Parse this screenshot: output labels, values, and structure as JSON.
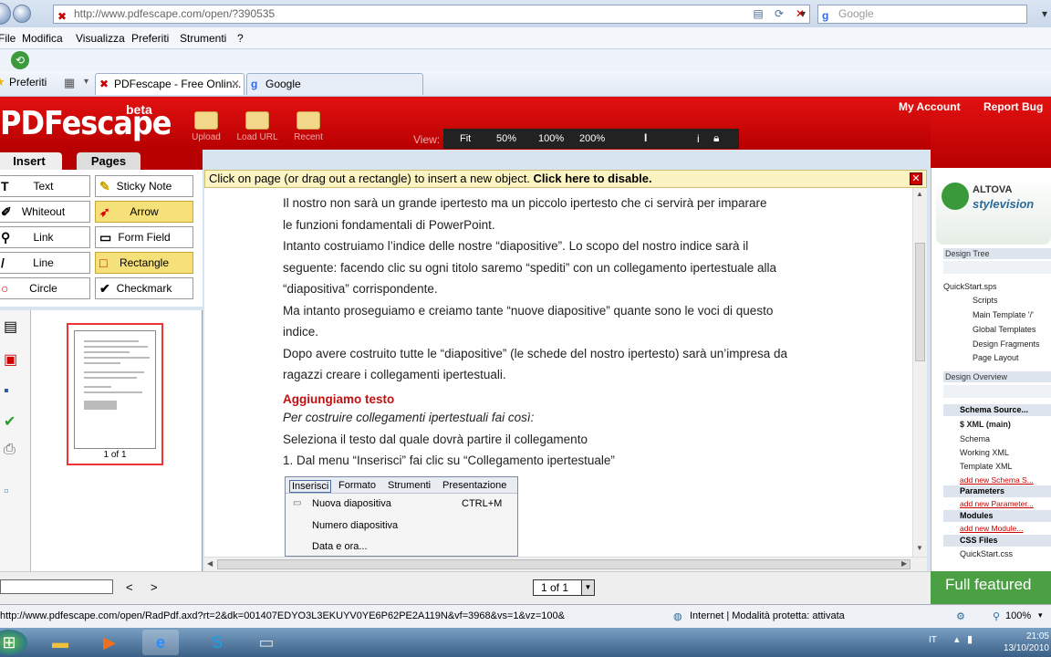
{
  "browser": {
    "url": "http://www.pdfescape.com/open/?390535",
    "search_placeholder": "Google",
    "menu": [
      "File",
      "Modifica",
      "Visualizza",
      "Preferiti",
      "Strumenti",
      "?"
    ],
    "favorites_label": "Preferiti",
    "tabs": [
      "PDFescape - Free Onlin...",
      "Google"
    ]
  },
  "app": {
    "logo": "PDFescape",
    "beta": "beta",
    "header_buttons": [
      "Upload",
      "Load URL",
      "Recent"
    ],
    "view_label": "View:",
    "zoom_options": [
      "Fit",
      "50%",
      "100%",
      "200%"
    ],
    "my_account": "My Account",
    "report_bug": "Report Bug",
    "panel_tabs": [
      "Insert",
      "Pages"
    ],
    "tools": [
      {
        "label": "Text",
        "icon": "T"
      },
      {
        "label": "Sticky Note",
        "icon": "✎"
      },
      {
        "label": "Whiteout",
        "icon": "✐"
      },
      {
        "label": "Arrow",
        "icon": "➶"
      },
      {
        "label": "Link",
        "icon": "⚲"
      },
      {
        "label": "Form Field",
        "icon": "▭"
      },
      {
        "label": "Line",
        "icon": "/"
      },
      {
        "label": "Rectangle",
        "icon": "□"
      },
      {
        "label": "Circle",
        "icon": "○"
      },
      {
        "label": "Checkmark",
        "icon": "✔"
      }
    ],
    "thumb_label": "1 of 1",
    "notice": "Click on page (or drag out a rectangle) to insert a new object.",
    "notice_link": "Click here to disable.",
    "page_select": "1 of 1",
    "nav_prev": "<",
    "nav_next": ">"
  },
  "document": {
    "lines": [
      "Il nostro non sarà un grande ipertesto ma un    piccolo      ipertesto che ci servirà per imparare",
      "le funzioni fondamentali di PowerPoint.",
      "Intanto costruiamo l’indice delle nostre “diapositive”. Lo scopo del nostro indice sarà il",
      "seguente: facendo clic su ogni titolo saremo “spediti” con un collegamento ipertestuale alla",
      "“diapositiva” corrispondente.",
      "Ma intanto proseguiamo e creiamo tante “nuove diapositive” quante sono le voci di questo",
      "indice.",
      "Dopo avere costruito tutte le “diapositive” (le schede del nostro ipertesto) sarà un’impresa da",
      "ragazzi creare i collegamenti ipertestuali."
    ],
    "heading": "Aggiungiamo testo",
    "italic": "Per costruire collegamenti ipertestuali fai così:",
    "line_a": "Seleziona il testo dal quale dovrà partire il collegamento",
    "line_b": "1. Dal menu “Inserisci” fai clic su “Collegamento ipertestuale”",
    "menu_bar": [
      "Inserisci",
      "Formato",
      "Strumenti",
      "Presentazione"
    ],
    "menu_items": [
      "Nuova diapositiva",
      "Numero diapositiva",
      "Data e ora..."
    ],
    "shortcut": "CTRL+M"
  },
  "right_panel": {
    "brand": "ALTOVA",
    "product": "stylevision",
    "design_tree": "Design Tree",
    "tree_items": [
      "QuickStart.sps",
      "Scripts",
      "Main Template '/'",
      "Global Templates",
      "Design Fragments",
      "Page Layout"
    ],
    "design_overview": "Design Overview",
    "sections": [
      "Schema Source...",
      "Parameters",
      "Modules",
      "CSS Files"
    ],
    "schema_items": [
      "$ XML (main)",
      "Schema",
      "Working XML",
      "Template XML"
    ],
    "links": [
      "add new Schema S...",
      "add new Parameter...",
      "add new Module..."
    ],
    "css_item": "QuickStart.css",
    "full_featured": "Full featured"
  },
  "status": {
    "url": "http://www.pdfescape.com/open/RadPdf.axd?rt=2&dk=001407EDYO3L3EKUYV0YE6P62PE2A119N&vf=3968&vs=1&vz=100&",
    "zone": "Internet | Modalità protetta: attivata",
    "zoom": "100%"
  },
  "taskbar": {
    "lang": "IT",
    "time": "21:05",
    "date": "13/10/2010"
  }
}
